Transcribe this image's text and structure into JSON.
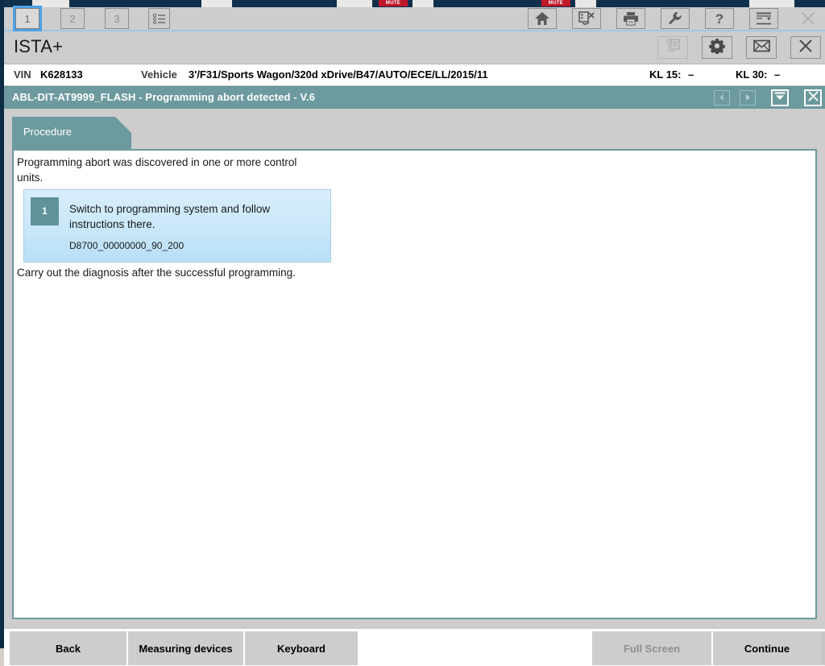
{
  "window": {
    "app_title": "ISTA+"
  },
  "toolbar": {
    "tabs": [
      {
        "label": "1",
        "active": true
      },
      {
        "label": "2",
        "active": false
      },
      {
        "label": "3",
        "active": false
      }
    ],
    "list_icon": "list-icon",
    "icons": [
      {
        "name": "home-icon",
        "label": "Home"
      },
      {
        "name": "vehicle-identification-icon",
        "label": "Vehicle identification"
      },
      {
        "name": "print-icon",
        "label": "Print"
      },
      {
        "name": "service-tools-icon",
        "label": "Service tools"
      },
      {
        "name": "help-icon",
        "label": "Help"
      },
      {
        "name": "export-icon",
        "label": "Export"
      },
      {
        "name": "close-icon",
        "label": "Close"
      }
    ]
  },
  "header": {
    "icons": [
      {
        "name": "copy-document-icon",
        "label": "Documents",
        "disabled": true
      },
      {
        "name": "gear-icon",
        "label": "Settings",
        "disabled": false
      },
      {
        "name": "mail-icon",
        "label": "Messages",
        "disabled": false
      },
      {
        "name": "close-icon",
        "label": "Close",
        "disabled": false
      }
    ]
  },
  "vehicle_info": {
    "vin_label": "VIN",
    "vin_value": "K628133",
    "vehicle_label": "Vehicle",
    "vehicle_value": "3'/F31/Sports Wagon/320d xDrive/B47/AUTO/ECE/LL/2015/11",
    "kl15_label": "KL 15:",
    "kl15_value": "–",
    "kl30_label": "KL 30:",
    "kl30_value": "–"
  },
  "module": {
    "title": "ABL-DIT-AT9999_FLASH - Programming abort detected - V.6",
    "nav": [
      {
        "name": "previous-arrow-icon",
        "label": "Previous"
      },
      {
        "name": "next-arrow-icon",
        "label": "Next"
      },
      {
        "name": "collapse-icon",
        "label": "Collapse"
      },
      {
        "name": "close-icon",
        "label": "Close"
      }
    ]
  },
  "tabs": [
    {
      "label": "Procedure",
      "active": true
    }
  ],
  "content": {
    "intro": "Programming abort was discovered in one or more control units.",
    "step": {
      "number": "1",
      "text": "Switch to programming system and follow instructions there.",
      "code": "D8700_00000000_90_200"
    },
    "outro": "Carry out the diagnosis after the successful programming."
  },
  "footer": {
    "back": "Back",
    "measuring_devices": "Measuring devices",
    "keyboard": "Keyboard",
    "full_screen": "Full Screen",
    "continue": "Continue"
  },
  "colors": {
    "teal": "#6c9a9e",
    "teal_dark": "#5f9399",
    "step_blue": "#c9e7f9",
    "toolbar_grey": "#cdcdcd",
    "accent_blue": "#4da3e8",
    "navy": "#0d2b45"
  },
  "background_app": {
    "mute_badge": "MUTE"
  }
}
